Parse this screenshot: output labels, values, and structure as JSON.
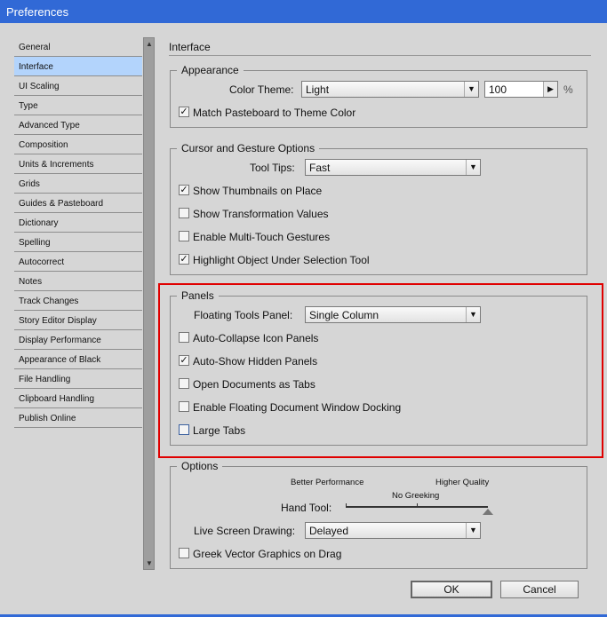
{
  "window": {
    "title": "Preferences"
  },
  "sidebar": {
    "items": [
      "General",
      "Interface",
      "UI Scaling",
      "Type",
      "Advanced Type",
      "Composition",
      "Units & Increments",
      "Grids",
      "Guides & Pasteboard",
      "Dictionary",
      "Spelling",
      "Autocorrect",
      "Notes",
      "Track Changes",
      "Story Editor Display",
      "Display Performance",
      "Appearance of Black",
      "File Handling",
      "Clipboard Handling",
      "Publish Online"
    ],
    "selected": "Interface"
  },
  "main": {
    "title": "Interface",
    "appearance": {
      "legend": "Appearance",
      "color_theme_label": "Color Theme:",
      "color_theme_value": "Light",
      "zoom_value": "100",
      "zoom_unit": "%",
      "match_pasteboard": {
        "label": "Match Pasteboard to Theme Color",
        "checked": true
      }
    },
    "cursor": {
      "legend": "Cursor and Gesture Options",
      "tooltips_label": "Tool Tips:",
      "tooltips_value": "Fast",
      "options": [
        {
          "label": "Show Thumbnails on Place",
          "checked": true
        },
        {
          "label": "Show Transformation Values",
          "checked": false
        },
        {
          "label": "Enable Multi-Touch Gestures",
          "checked": false
        },
        {
          "label": "Highlight Object Under Selection Tool",
          "checked": true
        }
      ]
    },
    "panels": {
      "legend": "Panels",
      "floating_label": "Floating Tools Panel:",
      "floating_value": "Single Column",
      "options": [
        {
          "label": "Auto-Collapse Icon Panels",
          "checked": false
        },
        {
          "label": "Auto-Show Hidden Panels",
          "checked": true
        },
        {
          "label": "Open Documents as Tabs",
          "checked": false
        },
        {
          "label": "Enable Floating Document Window Docking",
          "checked": false
        },
        {
          "label": "Large Tabs",
          "checked": false
        }
      ],
      "highlight_color": "#e00000"
    },
    "options": {
      "legend": "Options",
      "better_performance": "Better Performance",
      "higher_quality": "Higher Quality",
      "no_greeking": "No Greeking",
      "hand_tool_label": "Hand Tool:",
      "hand_tool_position": "Higher Quality",
      "live_label": "Live Screen Drawing:",
      "live_value": "Delayed",
      "greek": {
        "label": "Greek Vector Graphics on Drag",
        "checked": false
      }
    }
  },
  "buttons": {
    "ok": "OK",
    "cancel": "Cancel"
  }
}
